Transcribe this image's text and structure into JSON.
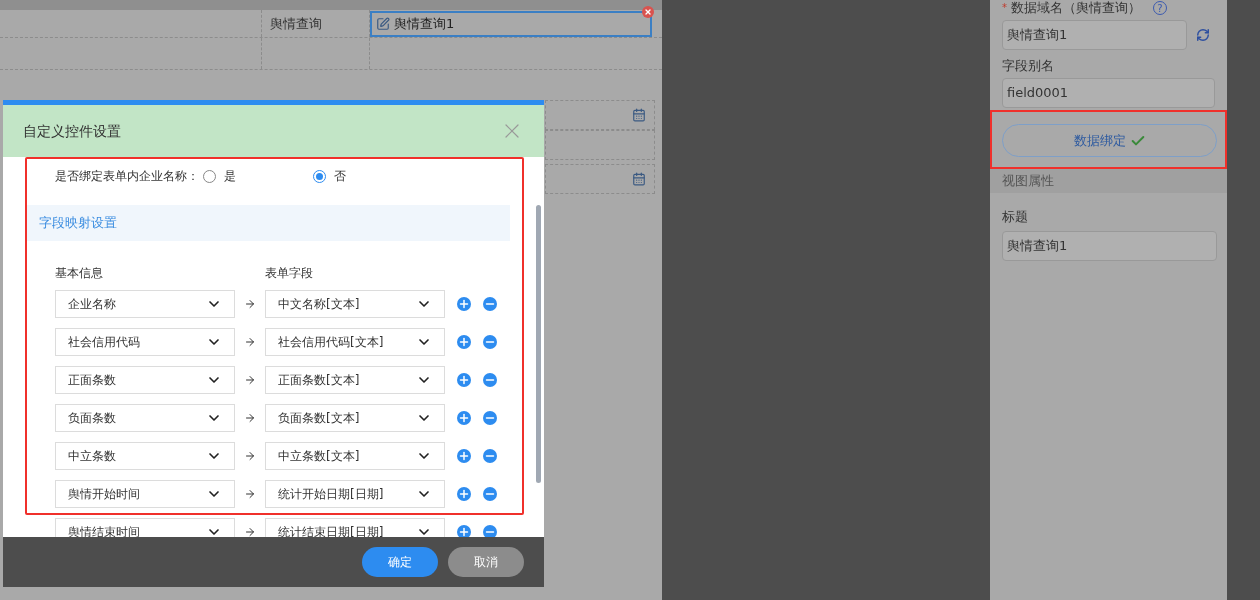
{
  "form": {
    "label": "舆情查询",
    "value": "舆情查询1"
  },
  "dialog": {
    "title": "自定义控件设置",
    "bind_question": {
      "label": "是否绑定表单内企业名称：",
      "options": [
        {
          "label": "是",
          "selected": false
        },
        {
          "label": "否",
          "selected": true
        }
      ]
    },
    "section_title": "字段映射设置",
    "columns": [
      "基本信息",
      "表单字段"
    ],
    "mappings": [
      {
        "source": "企业名称",
        "target": "中文名称[文本]"
      },
      {
        "source": "社会信用代码",
        "target": "社会信用代码[文本]"
      },
      {
        "source": "正面条数",
        "target": "正面条数[文本]"
      },
      {
        "source": "负面条数",
        "target": "负面条数[文本]"
      },
      {
        "source": "中立条数",
        "target": "中立条数[文本]"
      },
      {
        "source": "舆情开始时间",
        "target": "统计开始日期[日期]"
      },
      {
        "source": "舆情结束时间",
        "target": "统计结束日期[日期]"
      }
    ],
    "buttons": [
      {
        "label": "确定",
        "kind": "primary"
      },
      {
        "label": "取消",
        "kind": "secondary"
      }
    ]
  },
  "properties": {
    "fields": [
      {
        "label": "数据域名（舆情查询）",
        "required_mark": "*",
        "help": "?",
        "value": "舆情查询1"
      },
      {
        "label": "字段别名",
        "value": "field0001"
      }
    ],
    "bind_button": "数据绑定",
    "section": "视图属性",
    "title_field": {
      "label": "标题",
      "value": "舆情查询1"
    }
  }
}
